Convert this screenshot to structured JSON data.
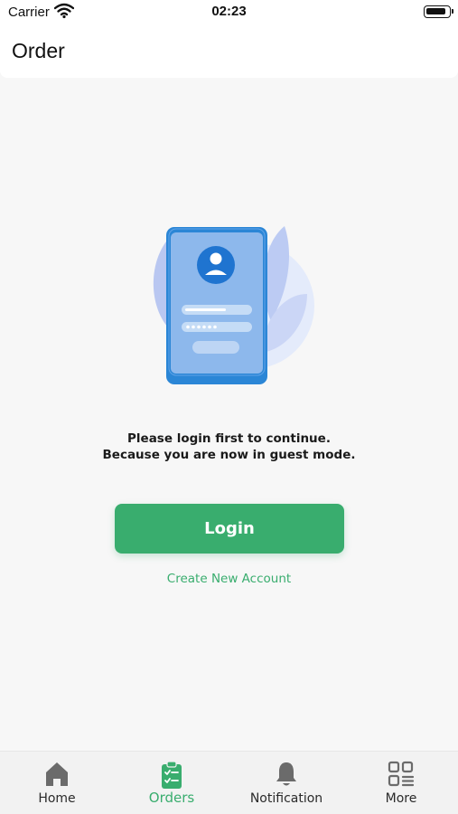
{
  "status_bar": {
    "carrier": "Carrier",
    "time": "02:23"
  },
  "header": {
    "title": "Order"
  },
  "guest_prompt": {
    "line1": "Please login first to continue.",
    "line2": "Because you are now in guest mode."
  },
  "actions": {
    "login_label": "Login",
    "create_account_label": "Create New Account"
  },
  "bottom_nav": {
    "items": [
      {
        "label": "Home",
        "icon": "home-icon"
      },
      {
        "label": "Orders",
        "icon": "orders-clipboard-icon",
        "active": true
      },
      {
        "label": "Notification",
        "icon": "bell-icon"
      },
      {
        "label": "More",
        "icon": "grid-icon"
      }
    ]
  },
  "colors": {
    "accent": "#39ad6e",
    "inactive_icon": "#6b6b6b",
    "background": "#f7f7f7"
  }
}
